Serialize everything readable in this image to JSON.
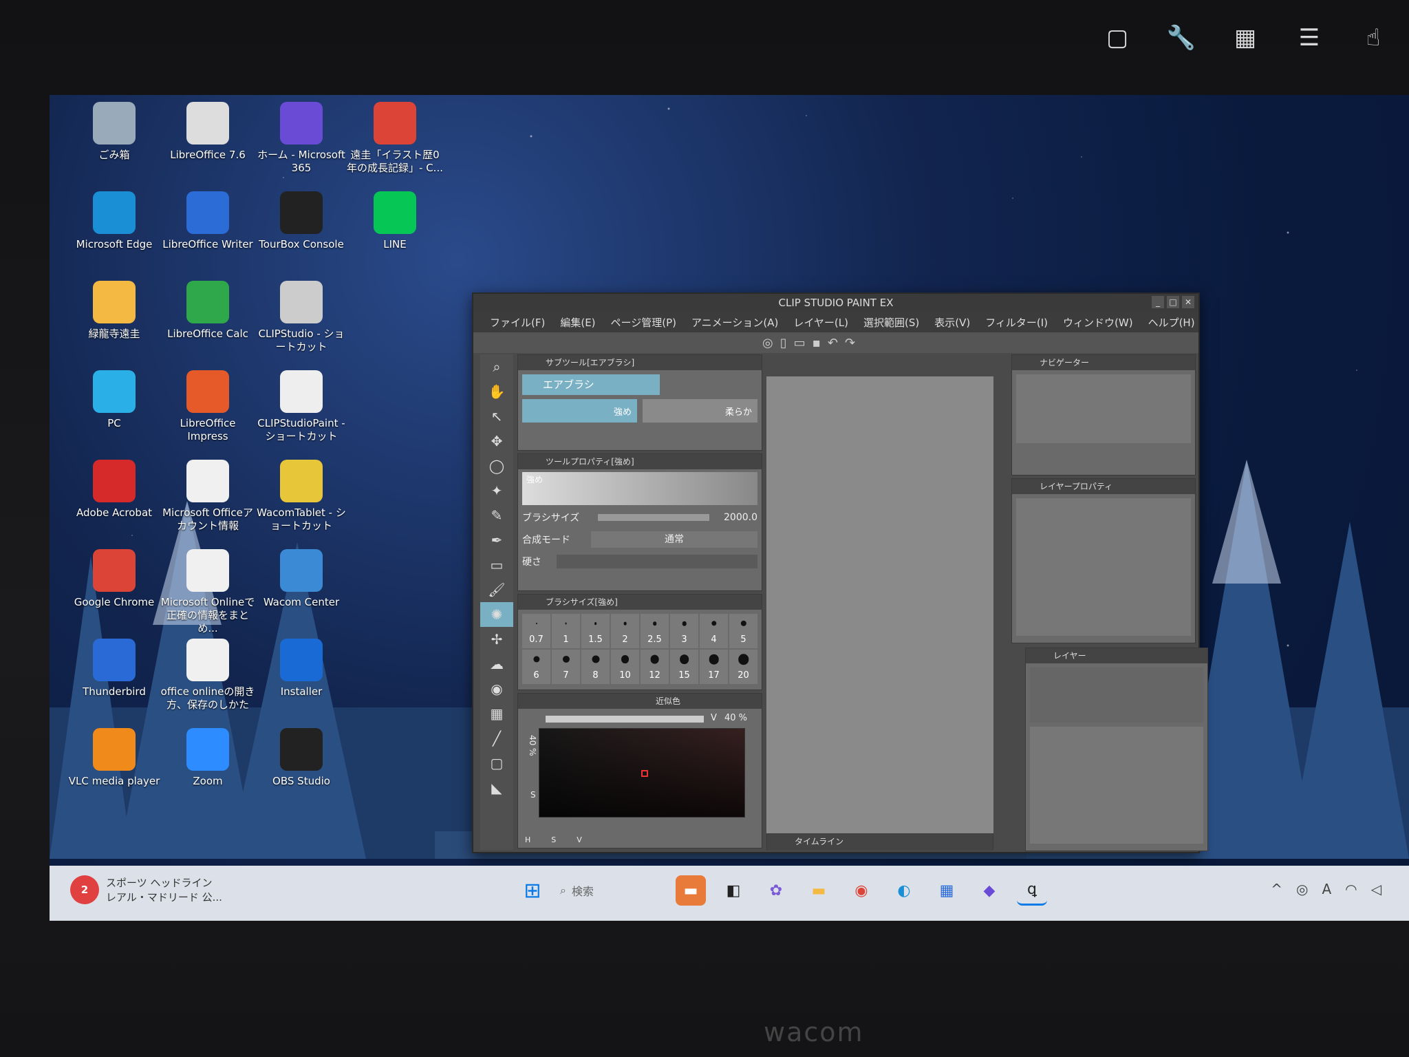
{
  "top_icons": [
    "window-icon",
    "wrench-icon",
    "keypad-icon",
    "menu-icon",
    "touch-icon"
  ],
  "desktop": [
    {
      "label": "ごみ箱",
      "icon": "recycle-bin-icon",
      "color": "#9ab"
    },
    {
      "label": "LibreOffice 7.6",
      "icon": "libreoffice-icon",
      "color": "#ddd"
    },
    {
      "label": "ホーム - Microsoft 365",
      "icon": "m365-icon",
      "color": "#6a4bd6"
    },
    {
      "label": "遠圭「イラスト歴0年の成長記録」- C...",
      "icon": "chrome-icon",
      "color": "#db4437"
    },
    {
      "label": "Microsoft Edge",
      "icon": "edge-icon",
      "color": "#1a8fd6"
    },
    {
      "label": "LibreOffice Writer",
      "icon": "writer-icon",
      "color": "#2b6cd6"
    },
    {
      "label": "TourBox Console",
      "icon": "tourbox-icon",
      "color": "#222"
    },
    {
      "label": "LINE",
      "icon": "line-icon",
      "color": "#06c755"
    },
    {
      "label": "緑龍寺遠圭",
      "icon": "folder-icon",
      "color": "#f4b942"
    },
    {
      "label": "LibreOffice Calc",
      "icon": "calc-icon",
      "color": "#2ea84a"
    },
    {
      "label": "CLIPStudio - ショートカット",
      "icon": "clipstudio-icon",
      "color": "#ccc"
    },
    {
      "label": "PC",
      "icon": "pc-icon",
      "color": "#2ab0e6"
    },
    {
      "label": "LibreOffice Impress",
      "icon": "impress-icon",
      "color": "#e65a2a"
    },
    {
      "label": "CLIPStudioPaint - ショートカット",
      "icon": "clipstudiopaint-icon",
      "color": "#eee"
    },
    {
      "label": "Adobe Acrobat",
      "icon": "acrobat-icon",
      "color": "#d62a2a"
    },
    {
      "label": "Microsoft Officeアカウント情報",
      "icon": "document-icon",
      "color": "#f0f0f0"
    },
    {
      "label": "WacomTablet - ショートカット",
      "icon": "wacom-tablet-icon",
      "color": "#e8c63a"
    },
    {
      "label": "Google Chrome",
      "icon": "chrome-icon",
      "color": "#db4437"
    },
    {
      "label": "Microsoft Onlineで正確の情報をまとめ...",
      "icon": "pdf-icon",
      "color": "#f0f0f0"
    },
    {
      "label": "Wacom Center",
      "icon": "wacom-center-icon",
      "color": "#3a8ad6"
    },
    {
      "label": "Thunderbird",
      "icon": "thunderbird-icon",
      "color": "#2a6ad6"
    },
    {
      "label": "office onlineの開き方、保存のしかた",
      "icon": "pdf-icon",
      "color": "#f0f0f0"
    },
    {
      "label": "Installer",
      "icon": "intel-icon",
      "color": "#1a6ad6"
    },
    {
      "label": "VLC media player",
      "icon": "vlc-icon",
      "color": "#f08a1a"
    },
    {
      "label": "Zoom",
      "icon": "zoom-icon",
      "color": "#2d8cff"
    },
    {
      "label": "OBS Studio",
      "icon": "obs-icon",
      "color": "#222"
    }
  ],
  "csp": {
    "title": "CLIP STUDIO PAINT EX",
    "menu": [
      "ファイル(F)",
      "編集(E)",
      "ページ管理(P)",
      "アニメーション(A)",
      "レイヤー(L)",
      "選択範囲(S)",
      "表示(V)",
      "フィルター(I)",
      "ウィンドウ(W)",
      "ヘルプ(H)"
    ],
    "subtool_header": "サブツール[エアブラシ]",
    "subtool": "エアブラシ",
    "brush_strong": "強め",
    "brush_soft": "柔らか",
    "toolprop_header": "ツールプロパティ[強め]",
    "preview_label": "強め",
    "brush_size_label": "ブラシサイズ",
    "brush_size_value": "2000.0",
    "blend_label": "合成モード",
    "blend_value": "通常",
    "hardness_label": "硬さ",
    "sizes_header": "ブラシサイズ[強め]",
    "sizes": [
      "0.7",
      "1",
      "1.5",
      "2",
      "2.5",
      "3",
      "4",
      "5",
      "6",
      "7",
      "8",
      "10",
      "12",
      "15",
      "17",
      "20"
    ],
    "color_tab": "近似色",
    "v_label": "V",
    "v_value": "40 %",
    "s_value": "40 %",
    "s_label": "S",
    "hsv": [
      "H",
      "S",
      "V"
    ],
    "navigator": "ナビゲーター",
    "layer_prop": "レイヤープロパティ",
    "layer": "レイヤー",
    "timeline": "タイムライン"
  },
  "taskbar": {
    "news_title": "スポーツ ヘッドライン",
    "news_sub": "レアル・マドリード 公...",
    "news_badge": "2",
    "search": "検索"
  },
  "bezel_brand": "wacom"
}
